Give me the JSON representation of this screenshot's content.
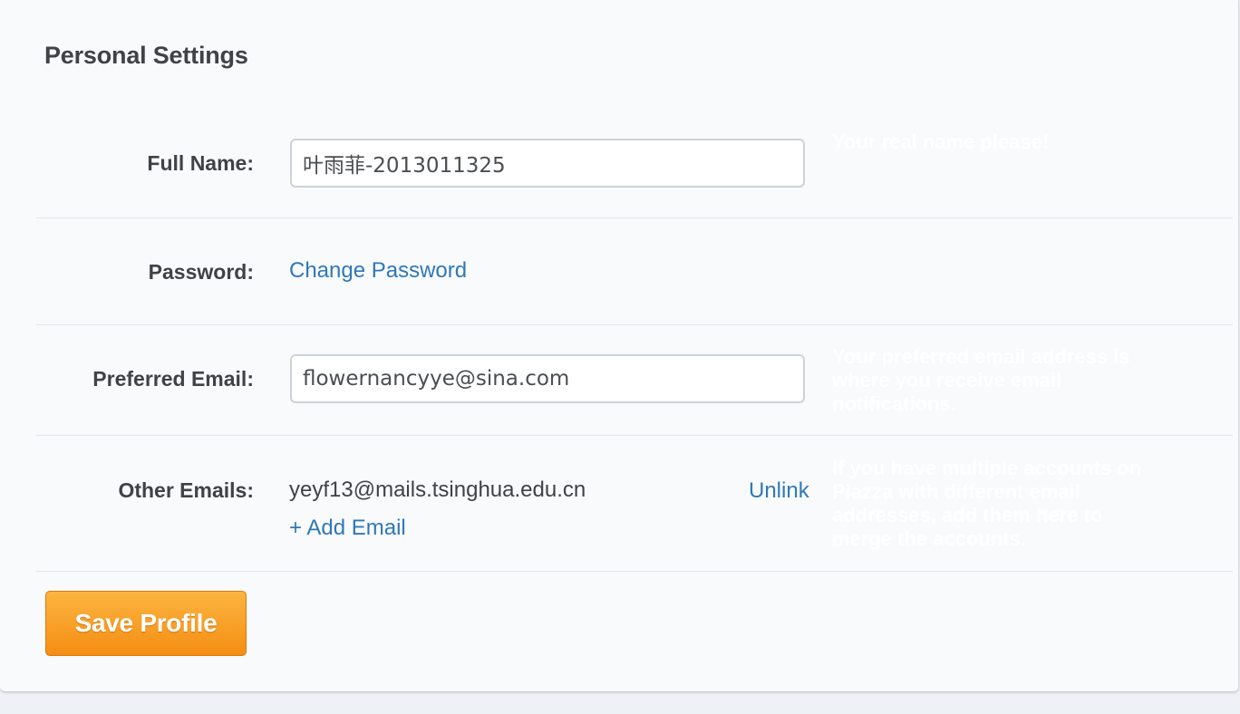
{
  "page": {
    "title": "Personal Settings"
  },
  "full_name": {
    "label": "Full Name:",
    "value": "叶雨菲-2013011325",
    "hint": "Your real name please!"
  },
  "password": {
    "label": "Password:",
    "link": "Change Password"
  },
  "preferred_email": {
    "label": "Preferred Email:",
    "value": "flowernancyye@sina.com",
    "hint": "Your preferred email address is where you receive email notifications."
  },
  "other_emails": {
    "label": "Other Emails:",
    "items": [
      {
        "email": "yeyf13@mails.tsinghua.edu.cn",
        "action": "Unlink"
      }
    ],
    "add_label": "+ Add Email",
    "hint": "If you have multiple accounts on Piazza with different email addresses, add them here to merge the accounts."
  },
  "save_button": {
    "label": "Save Profile"
  },
  "colors": {
    "link": "#2f78b7",
    "button": "#f58d13",
    "text": "#3f4346"
  }
}
